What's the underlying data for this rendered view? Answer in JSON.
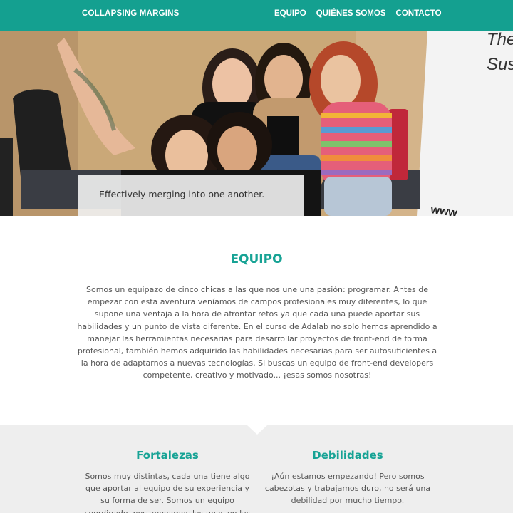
{
  "header": {
    "brand": "COLLAPSING MARGINS",
    "nav": [
      "EQUIPO",
      "QUIÉNES SOMOS",
      "CONTACTO"
    ]
  },
  "hero": {
    "caption": "Effectively merging into one another.",
    "wall_text": [
      "The",
      "Sus",
      "www"
    ]
  },
  "equipo": {
    "title": "EQUIPO",
    "text": "Somos un equipazo de cinco chicas a las que nos une una pasión: programar. Antes de empezar con esta aventura veníamos de campos profesionales muy diferentes, lo que supone una ventaja a la hora de afrontar retos ya que cada una puede aportar sus habilidades y un punto de vista diferente. En el curso de Adalab no solo hemos aprendido a manejar las herramientas necesarias para desarrollar proyectos de front-end de forma profesional, también hemos adquirido las habilidades necesarias para ser autosuficientes a la hora de adaptarnos a nuevas tecnologías. Si buscas un equipo de front-end developers competente, creativo y motivado... ¡esas somos nosotras!"
  },
  "strengths": {
    "title": "Fortalezas",
    "text": "Somos muy distintas, cada una tiene algo que aportar al equipo de su experiencia y su forma de ser. Somos un equipo coordinado, nos apoyamos las unas en las"
  },
  "weaknesses": {
    "title": "Debilidades",
    "text": "¡Aún estamos empezando! Pero somos cabezotas y trabajamos duro, no será una debilidad por mucho tiempo."
  },
  "colors": {
    "accent": "#17a395",
    "header_bg": "#14a090",
    "gray_section": "#eeeeee"
  }
}
